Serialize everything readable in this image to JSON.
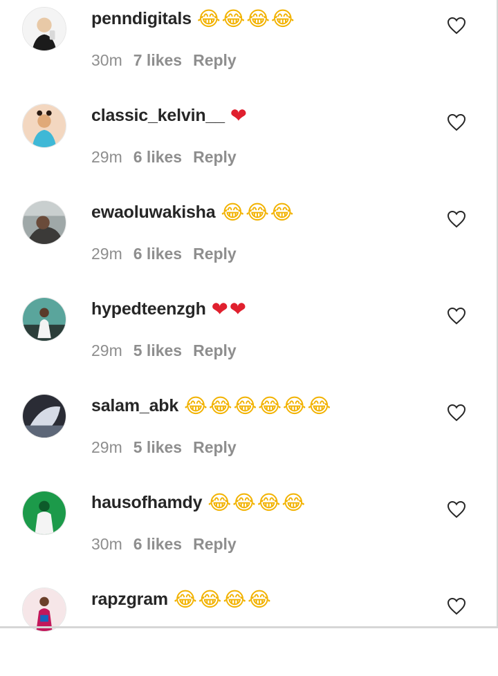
{
  "comments": [
    {
      "username": "penndigitals",
      "emojis": "😂😂😂😂",
      "time": "30m",
      "likes": "7 likes",
      "reply": "Reply",
      "avatar_colors": [
        "#f4f4f4",
        "#1b1b1b",
        "#e8c9a7"
      ]
    },
    {
      "username": "classic_kelvin__",
      "emojis": "❤️",
      "time": "29m",
      "likes": "6 likes",
      "reply": "Reply",
      "avatar_colors": [
        "#e0a978",
        "#3fb8d6",
        "#2a1a12"
      ]
    },
    {
      "username": "ewaoluwakisha",
      "emojis": "😂😂😂",
      "time": "29m",
      "likes": "6 likes",
      "reply": "Reply",
      "avatar_colors": [
        "#9fa8a8",
        "#3b3a38",
        "#6a4b3a"
      ]
    },
    {
      "username": "hypedteenzgh",
      "emojis": "❤️❤️",
      "time": "29m",
      "likes": "5 likes",
      "reply": "Reply",
      "avatar_colors": [
        "#5aa59c",
        "#2c3e3a",
        "#f3f3f3"
      ]
    },
    {
      "username": "salam_abk",
      "emojis": "😂😂😂😂😂😂",
      "time": "29m",
      "likes": "5 likes",
      "reply": "Reply",
      "avatar_colors": [
        "#5d6778",
        "#d6dbe6",
        "#2a2c35"
      ]
    },
    {
      "username": "hausofhamdy",
      "emojis": "😂😂😂😂",
      "time": "30m",
      "likes": "6 likes",
      "reply": "Reply",
      "avatar_colors": [
        "#1c9a4a",
        "#f4f4f4",
        "#0d5a2a"
      ]
    },
    {
      "username": "rapzgram",
      "emojis": "😂😂😂😂",
      "time": "",
      "likes": "",
      "reply": "",
      "avatar_colors": [
        "#f6e6e8",
        "#c2185b",
        "#1565c0"
      ]
    }
  ],
  "colors": {
    "username": "#262626",
    "meta": "#8e8e8e",
    "laugh": "#f2b200",
    "heart": "#e0202e"
  },
  "icons": {
    "like": "heart-outline-icon",
    "laugh": "face-with-tears-of-joy-emoji",
    "love": "red-heart-emoji"
  }
}
